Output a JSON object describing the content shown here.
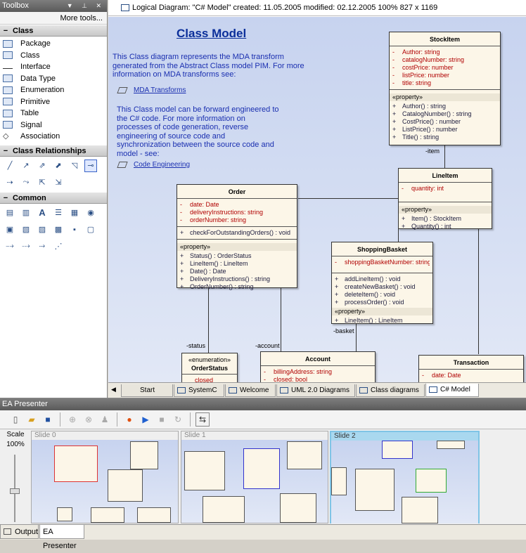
{
  "toolbox": {
    "title": "Toolbox",
    "more_tools": "More tools...",
    "sections": {
      "class": {
        "label": "Class",
        "items": [
          "Package",
          "Class",
          "Interface",
          "Data Type",
          "Enumeration",
          "Primitive",
          "Table",
          "Signal",
          "Association"
        ]
      },
      "relationships": {
        "label": "Class Relationships"
      },
      "common": {
        "label": "Common"
      }
    }
  },
  "diagram": {
    "header": "Logical Diagram: \"C# Model\"   created: 11.05.2005   modified: 02.12.2005   100%   827 x 1169",
    "title": "Class Model",
    "para1": "This Class diagram represents the MDA transform generated from the Abstract Class model PIM.  For more information on MDA transforms see:",
    "link1": "MDA Transforms",
    "para2": "This Class model can be forward engineered to the C# code.  For more information on processes of code generation, reverse engineering of source code and synchronization between the source code and model - see:",
    "link2": "Code Engineering",
    "classes": {
      "stockitem": {
        "name": "StockItem",
        "attrs": [
          [
            "-",
            "Author:  string"
          ],
          [
            "-",
            "catalogNumber:  string"
          ],
          [
            "-",
            "costPrice:  number"
          ],
          [
            "-",
            "listPrice:  number"
          ],
          [
            "-",
            "title:  string"
          ]
        ],
        "stereo": "«property»",
        "ops": [
          [
            "+",
            "Author() : string"
          ],
          [
            "+",
            "CatalogNumber() : string"
          ],
          [
            "+",
            "CostPrice() : number"
          ],
          [
            "+",
            "ListPrice() : number"
          ],
          [
            "+",
            "Title() : string"
          ]
        ]
      },
      "lineitem": {
        "name": "LineItem",
        "attrs": [
          [
            "-",
            "quantity:  int"
          ]
        ],
        "stereo": "«property»",
        "ops": [
          [
            "+",
            "Item() : StockItem"
          ],
          [
            "+",
            "Quantity() : int"
          ]
        ]
      },
      "order": {
        "name": "Order",
        "attrs": [
          [
            "-",
            "date:  Date"
          ],
          [
            "-",
            "deliveryInstructions:  string"
          ],
          [
            "-",
            "orderNumber:  string"
          ]
        ],
        "ops1": [
          [
            "+",
            "checkForOutstandingOrders() : void"
          ]
        ],
        "stereo": "«property»",
        "ops": [
          [
            "+",
            "Status() : OrderStatus"
          ],
          [
            "+",
            "LineItem() : LineItem"
          ],
          [
            "+",
            "Date() : Date"
          ],
          [
            "+",
            "DeliveryInstructions() : string"
          ],
          [
            "+",
            "OrderNumber() : string"
          ]
        ]
      },
      "basket": {
        "name": "ShoppingBasket",
        "attrs": [
          [
            "-",
            "shoppingBasketNumber:  string"
          ]
        ],
        "ops1": [
          [
            "+",
            "addLineItem() : void"
          ],
          [
            "+",
            "createNewBasket() : void"
          ],
          [
            "+",
            "deleteItem() : void"
          ],
          [
            "+",
            "processOrder() : void"
          ]
        ],
        "stereo": "«property»",
        "ops": [
          [
            "+",
            "LineItem() : LineItem"
          ]
        ]
      },
      "orderstatus": {
        "stereo": "«enumeration»",
        "name": "OrderStatus",
        "attrs": [
          [
            "",
            "closed"
          ]
        ]
      },
      "account": {
        "name": "Account",
        "attrs": [
          [
            "-",
            "billingAddress:  string"
          ],
          [
            "-",
            "closed:  bool"
          ]
        ]
      },
      "transaction": {
        "name": "Transaction",
        "attrs": [
          [
            "-",
            "date:  Date"
          ]
        ]
      }
    },
    "labels": {
      "item": "-item",
      "status": "-status",
      "account": "-account",
      "basket": "-basket"
    },
    "tabs": [
      "Start Page",
      "SystemC",
      "Welcome",
      "UML 2.0 Diagrams",
      "Class diagrams",
      "C# Model"
    ]
  },
  "presenter": {
    "title": "EA Presenter",
    "scale_label": "Scale",
    "scale_value": "100%",
    "slides": [
      "Slide 0",
      "Slide 1",
      "Slide 2"
    ]
  },
  "bottom_tabs": [
    "Output",
    "EA Presenter"
  ]
}
